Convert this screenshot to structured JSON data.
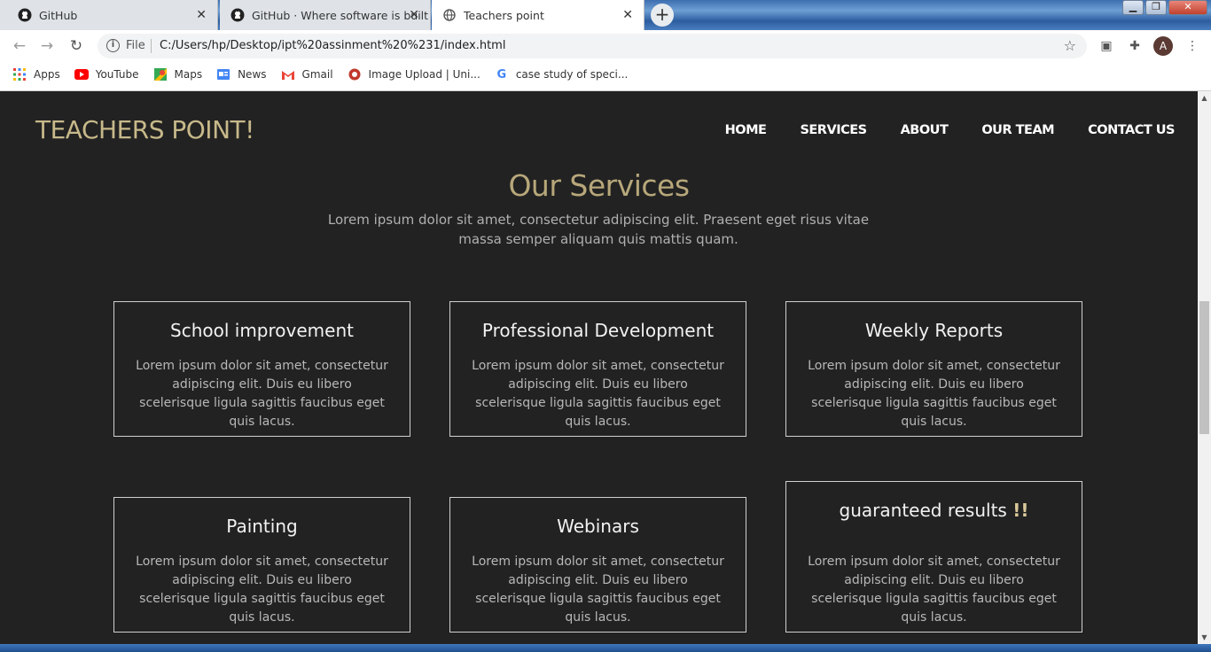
{
  "browser": {
    "tabs": [
      {
        "title": "GitHub",
        "icon": "github-icon"
      },
      {
        "title": "GitHub · Where software is built",
        "icon": "github-icon"
      },
      {
        "title": "Teachers point",
        "icon": "globe-icon"
      }
    ],
    "close_glyph": "✕",
    "new_tab": "+",
    "window_buttons": [
      "▁",
      "❐",
      "✕"
    ],
    "address_scheme": "File",
    "address_url": "C:/Users/hp/Desktop/ipt%20assinment%20%231/index.html",
    "avatar_letter": "A",
    "bookmarks": [
      {
        "label": "Apps",
        "icon": "apps-grid-icon"
      },
      {
        "label": "YouTube",
        "icon": "youtube-icon"
      },
      {
        "label": "Maps",
        "icon": "maps-icon"
      },
      {
        "label": "News",
        "icon": "news-icon"
      },
      {
        "label": "Gmail",
        "icon": "gmail-icon"
      },
      {
        "label": "Image Upload | Uni...",
        "icon": "image-upload-icon"
      },
      {
        "label": "case study of speci...",
        "icon": "google-icon"
      }
    ]
  },
  "site": {
    "brand": "TEACHERS POINT!",
    "nav": [
      "HOME",
      "SERVICES",
      "ABOUT",
      "OUR TEAM",
      "CONTACT US"
    ],
    "section_title": "Our Services",
    "section_subtitle": "Lorem ipsum dolor sit amet, consectetur adipiscing elit. Praesent eget risus vitae massa semper aliquam quis mattis quam.",
    "services": [
      {
        "title": "School improvement",
        "text": "Lorem ipsum dolor sit amet, consectetur adipiscing elit. Duis eu libero scelerisque ligula sagittis faucibus eget quis lacus."
      },
      {
        "title": "Professional Development",
        "text": "Lorem ipsum dolor sit amet, consectetur adipiscing elit. Duis eu libero scelerisque ligula sagittis faucibus eget quis lacus."
      },
      {
        "title": "Weekly Reports",
        "text": "Lorem ipsum dolor sit amet, consectetur adipiscing elit. Duis eu libero scelerisque ligula sagittis faucibus eget quis lacus."
      },
      {
        "title": "Painting",
        "text": "Lorem ipsum dolor sit amet, consectetur adipiscing elit. Duis eu libero scelerisque ligula sagittis faucibus eget quis lacus."
      },
      {
        "title": "Webinars",
        "text": "Lorem ipsum dolor sit amet, consectetur adipiscing elit. Duis eu libero scelerisque ligula sagittis faucibus eget quis lacus."
      },
      {
        "title": "guaranteed results",
        "title_suffix": "!!",
        "text": "Lorem ipsum dolor sit amet, consectetur adipiscing elit. Duis eu libero scelerisque ligula sagittis faucibus eget quis lacus."
      }
    ],
    "colors": {
      "background": "#222222",
      "brand": "#c7b98a",
      "title": "#b7a77a"
    }
  }
}
